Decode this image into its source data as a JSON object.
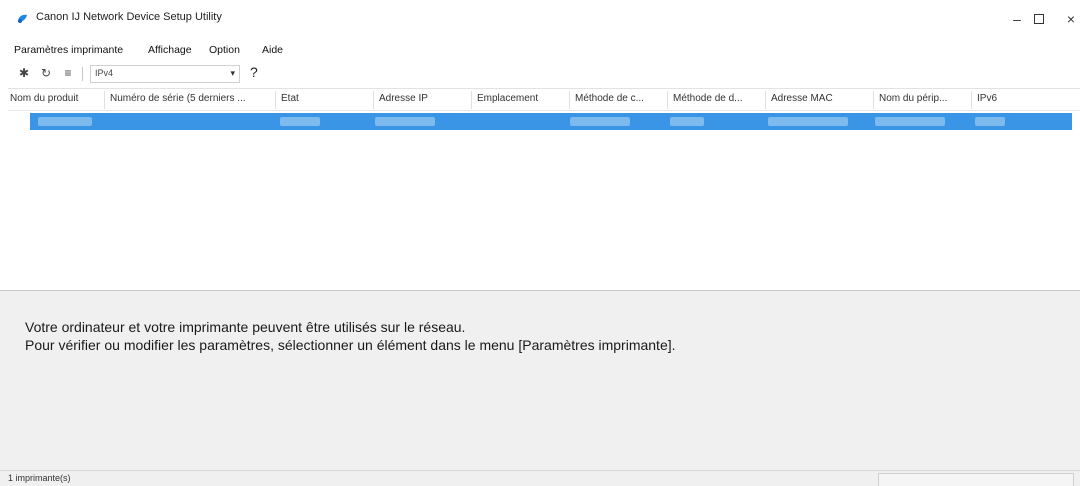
{
  "window": {
    "title": "Canon IJ Network Device Setup Utility",
    "controls": {
      "minimize": "–",
      "close": "×"
    }
  },
  "menu": [
    "Paramètres imprimante",
    "Affichage",
    "Option",
    "Aide"
  ],
  "toolbar": {
    "icons": [
      "gear-icon",
      "refresh-icon",
      "list-icon"
    ],
    "ip_select_value": "IPv4",
    "help_label": "?"
  },
  "list": {
    "columns": [
      "Nom du produit",
      "Numéro de série (5 derniers ...",
      "État",
      "Adresse IP",
      "Emplacement",
      "Méthode de c...",
      "Méthode de d...",
      "Adresse MAC",
      "Nom du périp...",
      "IPv6"
    ],
    "rows_count_selected": 1
  },
  "message": {
    "line1": "Votre ordinateur et votre imprimante peuvent être utilisés sur le réseau.",
    "line2": "Pour vérifier ou modifier les paramètres, sélectionner un élément dans le menu [Paramètres imprimante]."
  },
  "status": {
    "text": "1 imprimante(s)"
  },
  "colors": {
    "selection": "#3a95e6",
    "panel": "#f0f0f0",
    "accent_icon": "#1e88e5"
  }
}
